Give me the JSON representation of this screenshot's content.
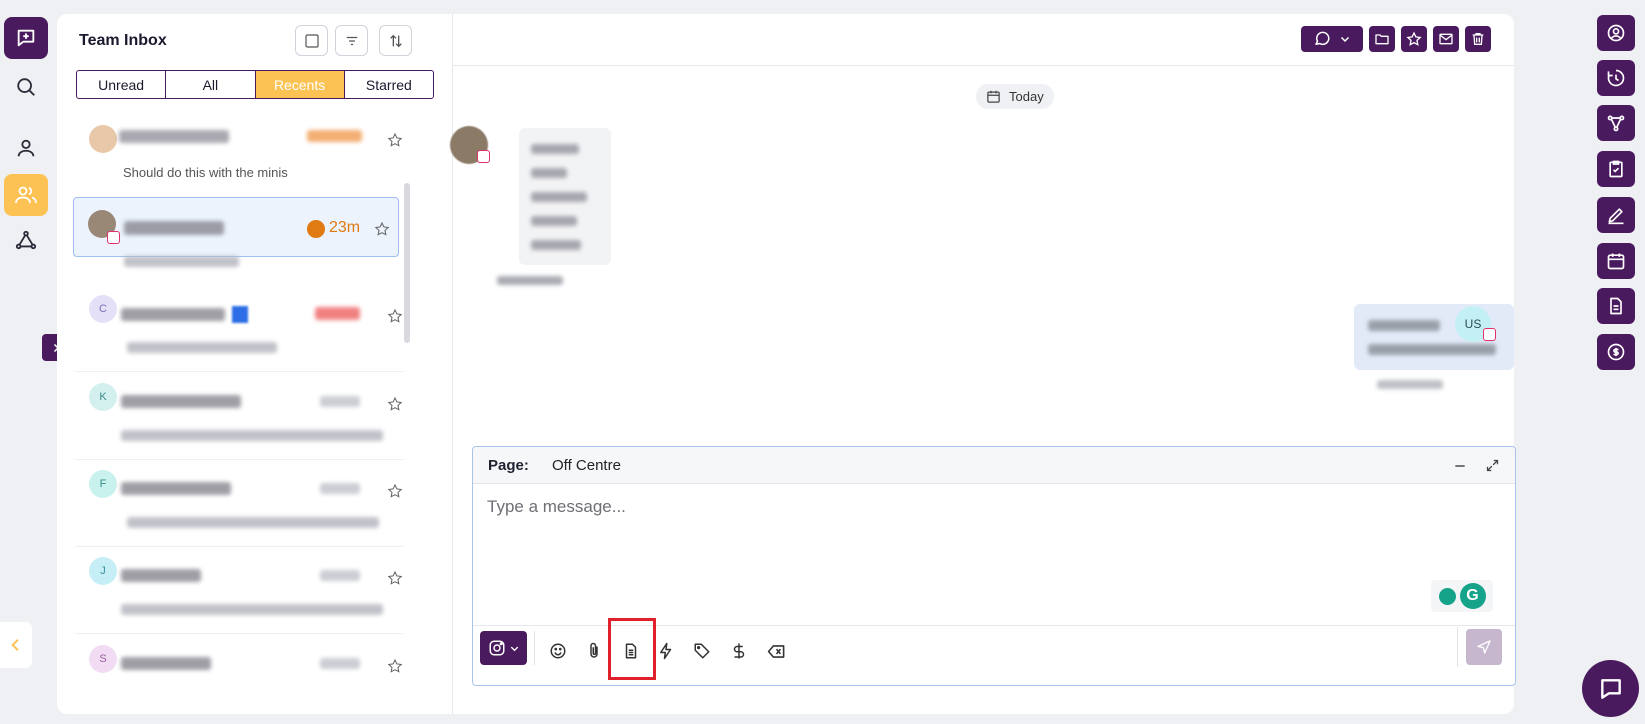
{
  "inbox": {
    "title": "Team Inbox",
    "tabs": [
      "Unread",
      "All",
      "Recents",
      "Starred"
    ],
    "active_tab": "Recents",
    "items": [
      {
        "avatar": "",
        "preview": "Should do this with the minis",
        "timer": ""
      },
      {
        "avatar": "",
        "preview": "",
        "timer": "23m"
      },
      {
        "avatar": "C",
        "preview": "",
        "timer": ""
      },
      {
        "avatar": "K",
        "preview": "",
        "timer": ""
      },
      {
        "avatar": "F",
        "preview": "",
        "timer": ""
      },
      {
        "avatar": "J",
        "preview": "",
        "timer": ""
      },
      {
        "avatar": "S",
        "preview": "",
        "timer": ""
      }
    ]
  },
  "chat": {
    "date_divider": "Today",
    "outgoing_avatar": "US",
    "composer": {
      "page_label": "Page:",
      "page_value": "Off Centre",
      "placeholder": "Type a message..."
    }
  },
  "icons": {
    "left_nav": [
      "compose-icon",
      "search-icon",
      "user-icon",
      "team-icon",
      "network-icon"
    ],
    "header_actions": [
      "checkbox-icon",
      "filter-icon",
      "sort-icon"
    ],
    "chat_actions": [
      "chat-bubble-icon",
      "folder-icon",
      "star-icon",
      "mail-icon",
      "trash-icon"
    ],
    "composer_tools": [
      "emoji-icon",
      "attachment-icon",
      "document-icon",
      "lightning-icon",
      "tag-icon",
      "dollar-icon",
      "clear-icon"
    ],
    "right_rail": [
      "profile-icon",
      "history-icon",
      "share-icon",
      "clipboard-icon",
      "pen-icon",
      "calendar-icon",
      "file-icon",
      "payment-icon"
    ]
  },
  "colors": {
    "brand": "#4a1a5e",
    "accent": "#fcc354",
    "timer": "#e07a12",
    "highlight": "#e0202a"
  }
}
